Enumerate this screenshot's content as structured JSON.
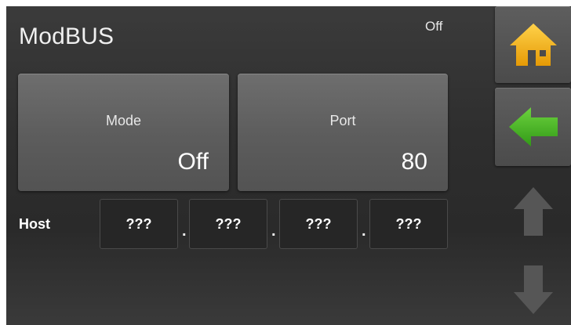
{
  "header": {
    "title": "ModBUS",
    "status": "Off"
  },
  "tiles": {
    "mode": {
      "label": "Mode",
      "value": "Off"
    },
    "port": {
      "label": "Port",
      "value": "80"
    }
  },
  "host": {
    "label": "Host",
    "octets": [
      "???",
      "???",
      "???",
      "???"
    ],
    "separator": "."
  },
  "nav": {
    "home_icon": "home-icon",
    "back_icon": "arrow-left-icon",
    "up_icon": "arrow-up-icon",
    "down_icon": "arrow-down-icon"
  },
  "colors": {
    "home_icon": "#f2b417",
    "back_icon": "#49b227",
    "disabled_arrow": "#5a5a5a"
  }
}
